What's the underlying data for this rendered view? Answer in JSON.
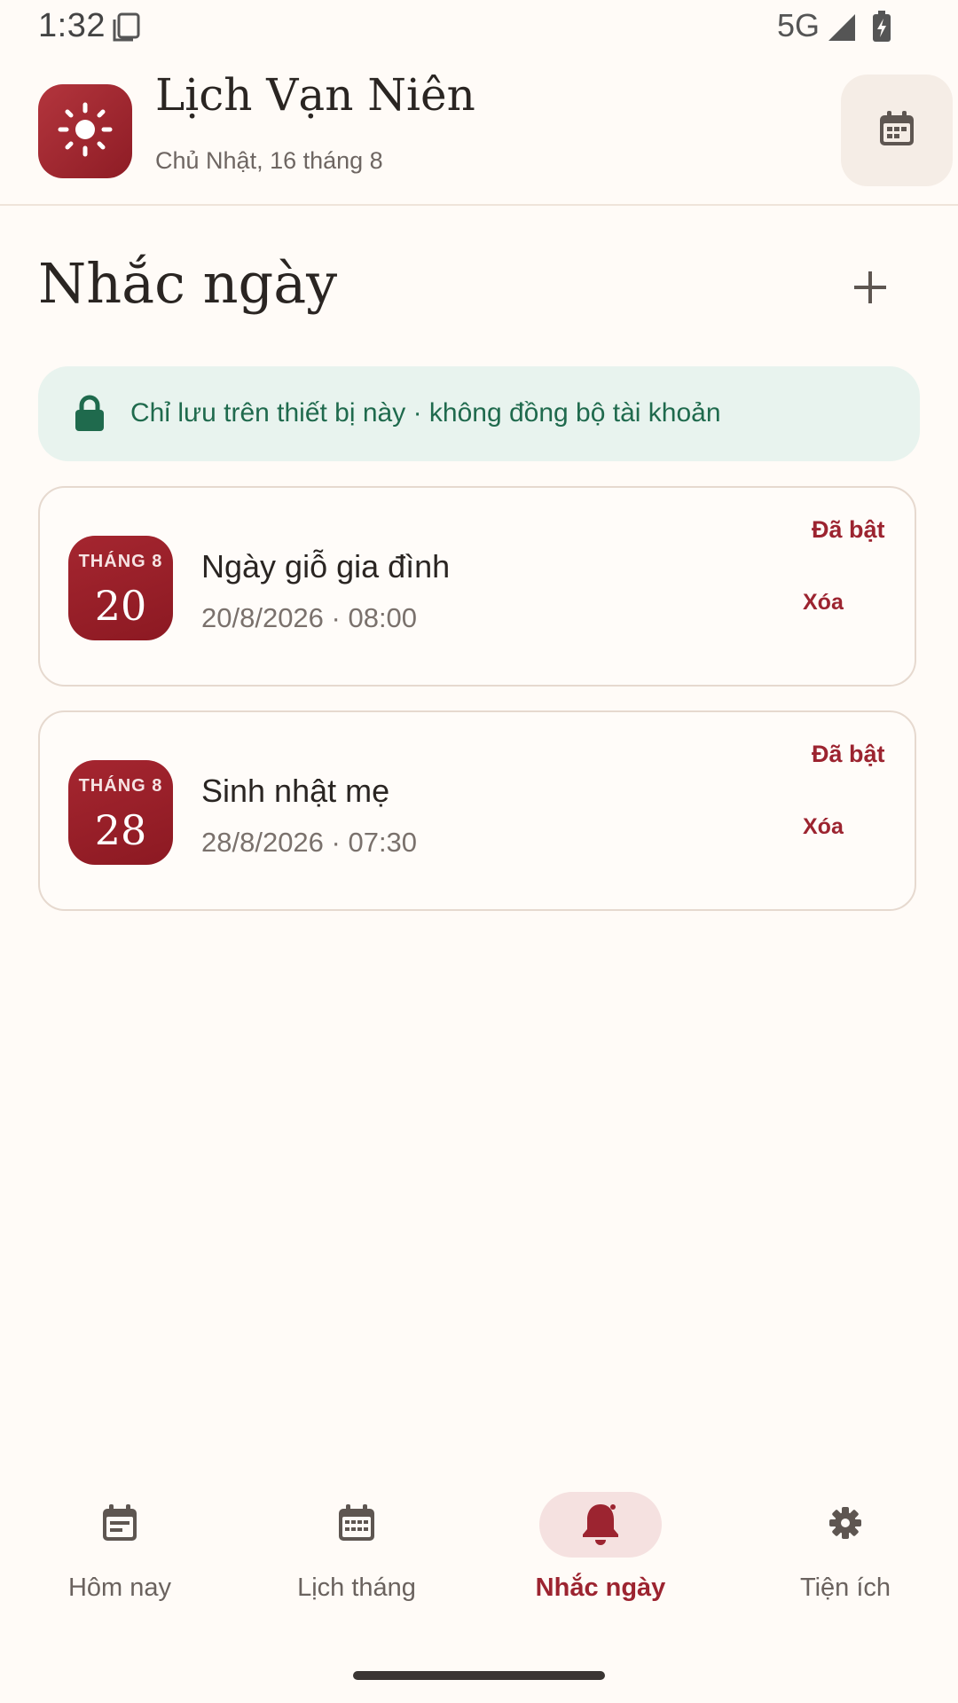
{
  "status_bar": {
    "time": "1:32",
    "network": "5G"
  },
  "header": {
    "title": "Lịch Vạn Niên",
    "subtitle": "Chủ Nhật, 16 tháng 8",
    "logo_icon": "sun-icon",
    "action_icon": "calendar-icon"
  },
  "page": {
    "title": "Nhắc ngày",
    "add_icon": "plus-icon"
  },
  "privacy_notice": {
    "icon": "lock-icon",
    "text": "Chỉ lưu trên thiết bị này · không đồng bộ tài khoản"
  },
  "reminders": [
    {
      "month_label": "THÁNG 8",
      "day": "20",
      "title": "Ngày giỗ gia đình",
      "datetime": "20/8/2026 · 08:00",
      "status": "Đã bật",
      "delete_label": "Xóa"
    },
    {
      "month_label": "THÁNG 8",
      "day": "28",
      "title": "Sinh nhật mẹ",
      "datetime": "28/8/2026 · 07:30",
      "status": "Đã bật",
      "delete_label": "Xóa"
    }
  ],
  "bottom_nav": {
    "items": [
      {
        "label": "Hôm nay",
        "icon": "today-icon",
        "active": false
      },
      {
        "label": "Lịch tháng",
        "icon": "month-calendar-icon",
        "active": false
      },
      {
        "label": "Nhắc ngày",
        "icon": "bell-icon",
        "active": true
      },
      {
        "label": "Tiện ích",
        "icon": "gear-icon",
        "active": false
      }
    ]
  },
  "colors": {
    "accent": "#9C2430",
    "background": "#FFFBF7",
    "notice_bg": "#E8F3EE",
    "notice_text": "#1F6A4D"
  }
}
